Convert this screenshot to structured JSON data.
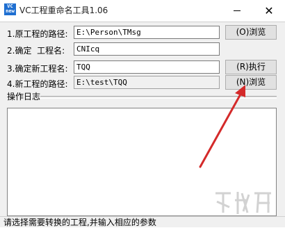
{
  "window": {
    "icon_text": [
      "VC",
      "new"
    ],
    "title": "VC工程重命名工具1.06"
  },
  "form": {
    "rows": [
      {
        "label": "1.原工程的路径:",
        "value": "E:\\Person\\TMsg",
        "button": "(O)浏览"
      },
      {
        "label": "2.确定  工程名:",
        "value": "CNIcq"
      },
      {
        "label": "3.确定新工程名:",
        "value": "TQQ",
        "button": "(R)执行"
      },
      {
        "label": "4.新工程的路径:",
        "value": "E:\\test\\TQQ",
        "button": "(N)浏览"
      }
    ]
  },
  "log": {
    "label": "操作日志"
  },
  "status": {
    "text": "请选择需要转换的工程,并输入相应的参数"
  },
  "colors": {
    "annotation_arrow": "#d42a2a",
    "icon_bg": "#1f6fd1"
  }
}
